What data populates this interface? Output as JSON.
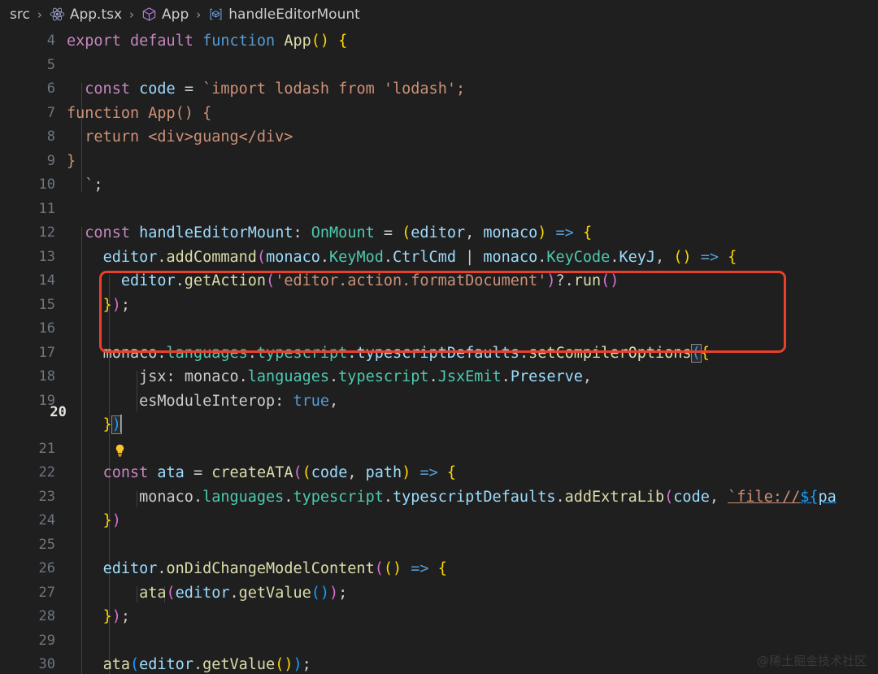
{
  "breadcrumb": {
    "items": [
      {
        "label": "src",
        "icon": null
      },
      {
        "label": "App.tsx",
        "icon": "react-icon"
      },
      {
        "label": "App",
        "icon": "cube-symbol-icon"
      },
      {
        "label": "handleEditorMount",
        "icon": "method-symbol-icon"
      }
    ],
    "separator": "›"
  },
  "editor": {
    "active_line": 20,
    "lightbulb_line": 20,
    "first_visible_line": 4,
    "last_visible_line": 30,
    "cursor": {
      "line": 20,
      "column": 4
    },
    "annotation": {
      "shape": "rectangle",
      "color": "#e8402a",
      "covers_lines": "13-15"
    },
    "lines": [
      {
        "n": 4,
        "text": "export default function App() {"
      },
      {
        "n": 5,
        "text": ""
      },
      {
        "n": 6,
        "text": "  const code = `import lodash from 'lodash';"
      },
      {
        "n": 7,
        "text": "function App() {"
      },
      {
        "n": 8,
        "text": "  return <div>guang</div>"
      },
      {
        "n": 9,
        "text": "}"
      },
      {
        "n": 10,
        "text": "  `;"
      },
      {
        "n": 11,
        "text": ""
      },
      {
        "n": 12,
        "text": "  const handleEditorMount: OnMount = (editor, monaco) => {"
      },
      {
        "n": 13,
        "text": "    editor.addCommand(monaco.KeyMod.CtrlCmd | monaco.KeyCode.KeyJ, () => {"
      },
      {
        "n": 14,
        "text": "      editor.getAction('editor.action.formatDocument')?.run()"
      },
      {
        "n": 15,
        "text": "    });"
      },
      {
        "n": 16,
        "text": ""
      },
      {
        "n": 17,
        "text": "    monaco.languages.typescript.typescriptDefaults.setCompilerOptions({"
      },
      {
        "n": 18,
        "text": "        jsx: monaco.languages.typescript.JsxEmit.Preserve,"
      },
      {
        "n": 19,
        "text": "        esModuleInterop: true,"
      },
      {
        "n": 20,
        "text": "    })"
      },
      {
        "n": 21,
        "text": ""
      },
      {
        "n": 22,
        "text": "    const ata = createATA((code, path) => {"
      },
      {
        "n": 23,
        "text": "        monaco.languages.typescript.typescriptDefaults.addExtraLib(code, `file://${pa"
      },
      {
        "n": 24,
        "text": "    })"
      },
      {
        "n": 25,
        "text": ""
      },
      {
        "n": 26,
        "text": "    editor.onDidChangeModelContent(() => {"
      },
      {
        "n": 27,
        "text": "        ata(editor.getValue());"
      },
      {
        "n": 28,
        "text": "    });"
      },
      {
        "n": 29,
        "text": ""
      },
      {
        "n": 30,
        "text": "    ata(editor.getValue());"
      }
    ]
  },
  "watermark": {
    "text": "@稀土掘金技术社区"
  },
  "colors": {
    "background": "#1f1f1f",
    "line_number": "#6e7681",
    "active_line_number": "#e6e6e6",
    "annotation": "#e8402a",
    "keyword": "#c586c0",
    "function": "#dcdcaa",
    "variable": "#9cdcfe",
    "type": "#4ec9b0",
    "string": "#ce9178",
    "bracket1": "#ffd700",
    "bracket2": "#da70d6",
    "bracket3": "#179fff"
  }
}
